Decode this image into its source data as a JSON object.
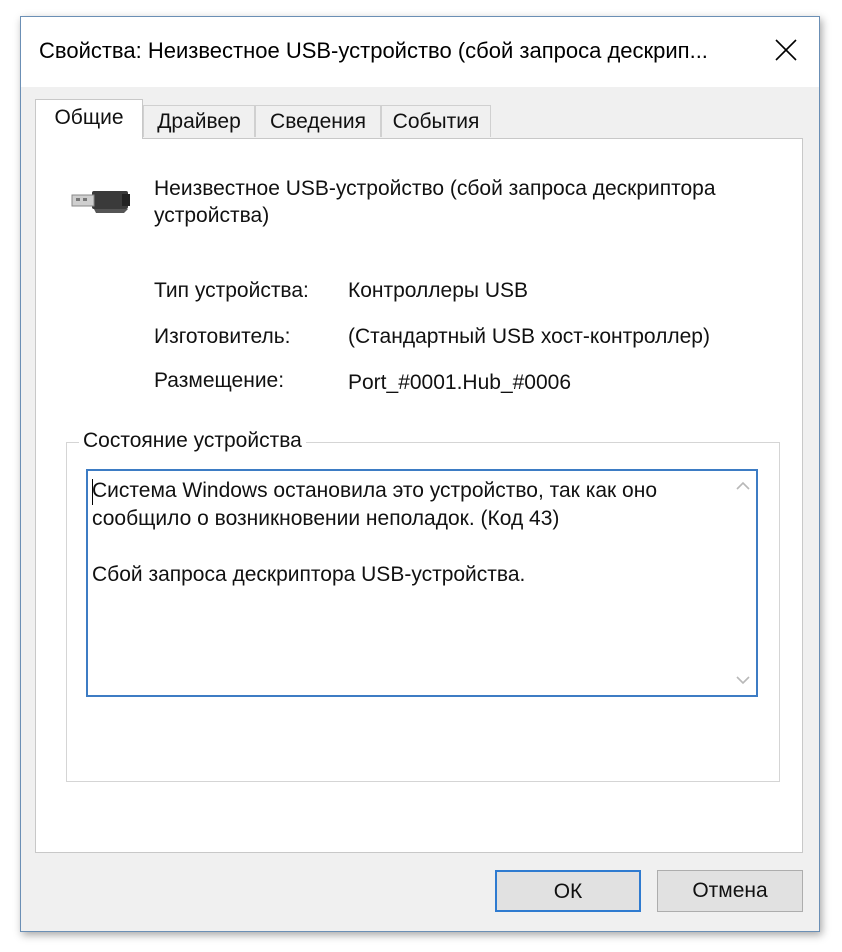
{
  "window": {
    "title": "Свойства: Неизвестное USB-устройство (сбой запроса дескрип..."
  },
  "tabs": [
    {
      "label": "Общие",
      "active": true
    },
    {
      "label": "Драйвер",
      "active": false
    },
    {
      "label": "Сведения",
      "active": false
    },
    {
      "label": "События",
      "active": false
    }
  ],
  "device": {
    "icon": "usb-cable-icon",
    "name": "Неизвестное USB-устройство (сбой запроса дескриптора устройства)"
  },
  "properties": [
    {
      "label": "Тип устройства:",
      "value": "Контроллеры USB"
    },
    {
      "label": "Изготовитель:",
      "value": "(Стандартный USB хост-контроллер)"
    },
    {
      "label": "Размещение:",
      "value": "Port_#0001.Hub_#0006"
    }
  ],
  "status": {
    "legend": "Состояние устройства",
    "line1": "Система Windows остановила это устройство, так как оно",
    "line2": "сообщило о возникновении неполадок. (Код 43)",
    "line3": "Сбой запроса дескриптора USB-устройства."
  },
  "buttons": {
    "ok": "ОК",
    "cancel": "Отмена"
  },
  "colors": {
    "accent": "#3d7cc4",
    "window_border": "#6b8fb5"
  }
}
